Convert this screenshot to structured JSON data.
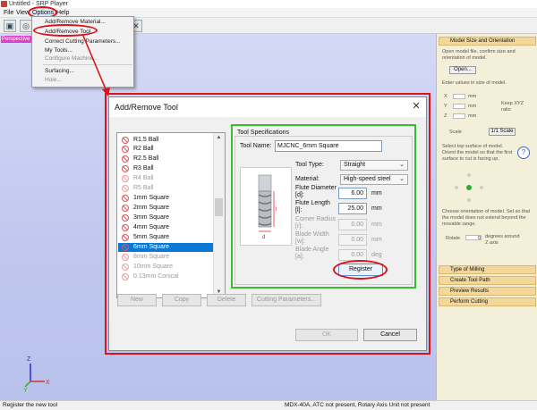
{
  "app": {
    "title": "Untitled - SRP Player"
  },
  "menubar": {
    "items": [
      "File",
      "View",
      "Options",
      "Help"
    ]
  },
  "options_menu": {
    "items": [
      {
        "label": "Add/Remove Material...",
        "enabled": true
      },
      {
        "label": "Add/Remove Tool...",
        "enabled": true
      },
      {
        "label": "Correct Cutting Parameters...",
        "enabled": true
      },
      {
        "label": "My Tools...",
        "enabled": true
      },
      {
        "label": "Configure Machine...",
        "enabled": false
      },
      {
        "label": "Surfacing...",
        "enabled": true
      },
      {
        "label": "Hole...",
        "enabled": false
      }
    ]
  },
  "viewport": {
    "tab_label": "Perspective"
  },
  "dialog": {
    "title": "Add/Remove Tool",
    "tools": [
      {
        "name": "R1.5 Ball",
        "enabled": true,
        "selected": false
      },
      {
        "name": "R2 Ball",
        "enabled": true,
        "selected": false
      },
      {
        "name": "R2.5 Ball",
        "enabled": true,
        "selected": false
      },
      {
        "name": "R3 Ball",
        "enabled": true,
        "selected": false
      },
      {
        "name": "R4 Ball",
        "enabled": false,
        "selected": false
      },
      {
        "name": "R5 Ball",
        "enabled": false,
        "selected": false
      },
      {
        "name": "1mm Square",
        "enabled": true,
        "selected": false
      },
      {
        "name": "2mm Square",
        "enabled": true,
        "selected": false
      },
      {
        "name": "3mm Square",
        "enabled": true,
        "selected": false
      },
      {
        "name": "4mm Square",
        "enabled": true,
        "selected": false
      },
      {
        "name": "5mm Square",
        "enabled": true,
        "selected": false
      },
      {
        "name": "6mm Square",
        "enabled": true,
        "selected": true
      },
      {
        "name": "8mm Square",
        "enabled": false,
        "selected": false
      },
      {
        "name": "10mm Square",
        "enabled": false,
        "selected": false
      },
      {
        "name": "0.13mm Conical",
        "enabled": false,
        "selected": false
      }
    ],
    "list_buttons": {
      "new": "New",
      "copy": "Copy",
      "delete": "Delete",
      "cutting_parameters": "Cutting Parameters..."
    },
    "specs": {
      "group_title": "Tool Specifications",
      "tool_name_label": "Tool Name:",
      "tool_name_value": "MJCNC_6mm Square",
      "tool_type_label": "Tool Type:",
      "tool_type_value": "Straight",
      "material_label": "Material:",
      "material_value": "High-speed steel",
      "flute_diameter_label": "Flute Diameter [d]:",
      "flute_diameter_value": "6.00",
      "flute_diameter_unit": "mm",
      "flute_length_label": "Flute Length [l]:",
      "flute_length_value": "25.00",
      "flute_length_unit": "mm",
      "corner_radius_label": "Corner Radius [r]:",
      "corner_radius_value": "0.00",
      "corner_radius_unit": "mm",
      "blade_width_label": "Blade Width [w]:",
      "blade_width_value": "0.00",
      "blade_width_unit": "mm",
      "blade_angle_label": "Blade Angle [a]:",
      "blade_angle_value": "0.00",
      "blade_angle_unit": "deg",
      "register_label": "Register",
      "diagram_d_label": "d",
      "diagram_l_label": "l"
    },
    "ok_label": "OK",
    "cancel_label": "Cancel"
  },
  "right_panel": {
    "header1": "Model Size and Orientation",
    "open_model_text": "Open model file, confirm size and orientation of model.",
    "open_button": "Open...",
    "enter_size_text": "Enter values in size of model.",
    "x_label": "X",
    "y_label": "Y",
    "z_label": "Z",
    "unit_mm": "mm",
    "keep_xyz_label": "Keep XYZ ratio",
    "scale_label": "Scale",
    "scale_button": "1/1 Scale",
    "select_surface_text": "Select top surface of model. Orient the model so that the first surface to cut is facing up.",
    "orientation_text": "Choose orientation of model. Set so that the model does not extend beyond the movable range.",
    "rotate_label": "Rotate",
    "rotate_value": "0",
    "degrees_text": "degrees around Z axis",
    "sections": [
      "Type of Milling",
      "Create Tool Path",
      "Preview Results",
      "Perform Cutting"
    ]
  },
  "statusbar": {
    "left": "Register the new tool",
    "right": "MDX-40A, ATC not present, Rotary Axis Unit not present"
  },
  "axis": {
    "x": "X",
    "y": "Y",
    "z": "Z"
  },
  "colors": {
    "annotation_red": "#d9141b",
    "annotation_green": "#35c02f",
    "selection_blue": "#0a78d7"
  }
}
